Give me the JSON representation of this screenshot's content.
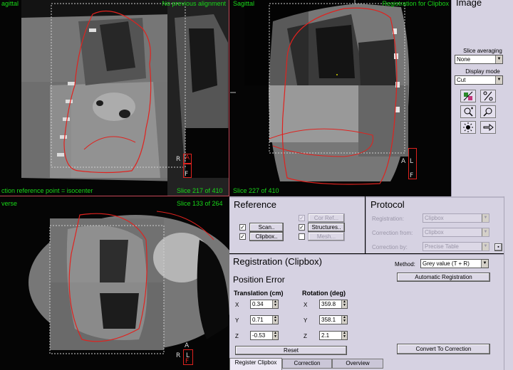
{
  "viewports": {
    "coronal": {
      "title": "agittal",
      "top_right": "No previous alignment",
      "bottom_left": "ction reference point = isocenter",
      "slice": "Slice 217 of 410",
      "orient": {
        "left": "R",
        "top": "A",
        "right": "L",
        "bottom": "F"
      }
    },
    "sagittal": {
      "title": "Sagittal",
      "top_right": "Registration for Clipbox",
      "slice": "Slice 227 of 410",
      "orient": {
        "left": "A",
        "right": "L",
        "bottom": "F"
      }
    },
    "transverse": {
      "title": "verse",
      "slice": "Slice 133 of 264",
      "orient": {
        "top": "A",
        "left": "R",
        "right": "L",
        "bottom": "F"
      }
    }
  },
  "image_panel": {
    "title": "Image",
    "slice_averaging_label": "Slice averaging",
    "slice_averaging_value": "None",
    "display_mode_label": "Display mode",
    "display_mode_value": "Cut"
  },
  "reference": {
    "title": "Reference",
    "scan_label": "Scan..",
    "clipbox_label": "Clipbox..",
    "corref_label": "Cor Ref...",
    "structures_label": "Structures..",
    "mesh_label": "Mesh..."
  },
  "protocol": {
    "title": "Protocol",
    "registration_label": "Registration:",
    "registration_value": "Clipbox",
    "correction_from_label": "Correction from:",
    "correction_from_value": "Clipbox",
    "correction_by_label": "Correction by:",
    "correction_by_value": "Precise Table"
  },
  "registration": {
    "title": "Registration (Clipbox)",
    "method_label": "Method:",
    "method_value": "Grey value (T + R)",
    "auto_button": "Automatic Registration",
    "position_error_title": "Position Error",
    "translation_label": "Translation (cm)",
    "rotation_label": "Rotation (deg)",
    "tx_label": "X",
    "tx_value": "0.34",
    "ty_label": "Y",
    "ty_value": "0.71",
    "tz_label": "Z",
    "tz_value": "-0.53",
    "rx_label": "X",
    "rx_value": "359.8",
    "ry_label": "Y",
    "ry_value": "358.1",
    "rz_label": "Z",
    "rz_value": "2.1",
    "reset_button": "Reset",
    "convert_button": "Convert To Correction"
  },
  "tabs": [
    "Register Clipbox",
    "Correction",
    "Overview"
  ],
  "colors": {
    "overlay_green": "#19d819",
    "contour_red": "#e0221e",
    "panel_bg": "#d6d2e2"
  }
}
